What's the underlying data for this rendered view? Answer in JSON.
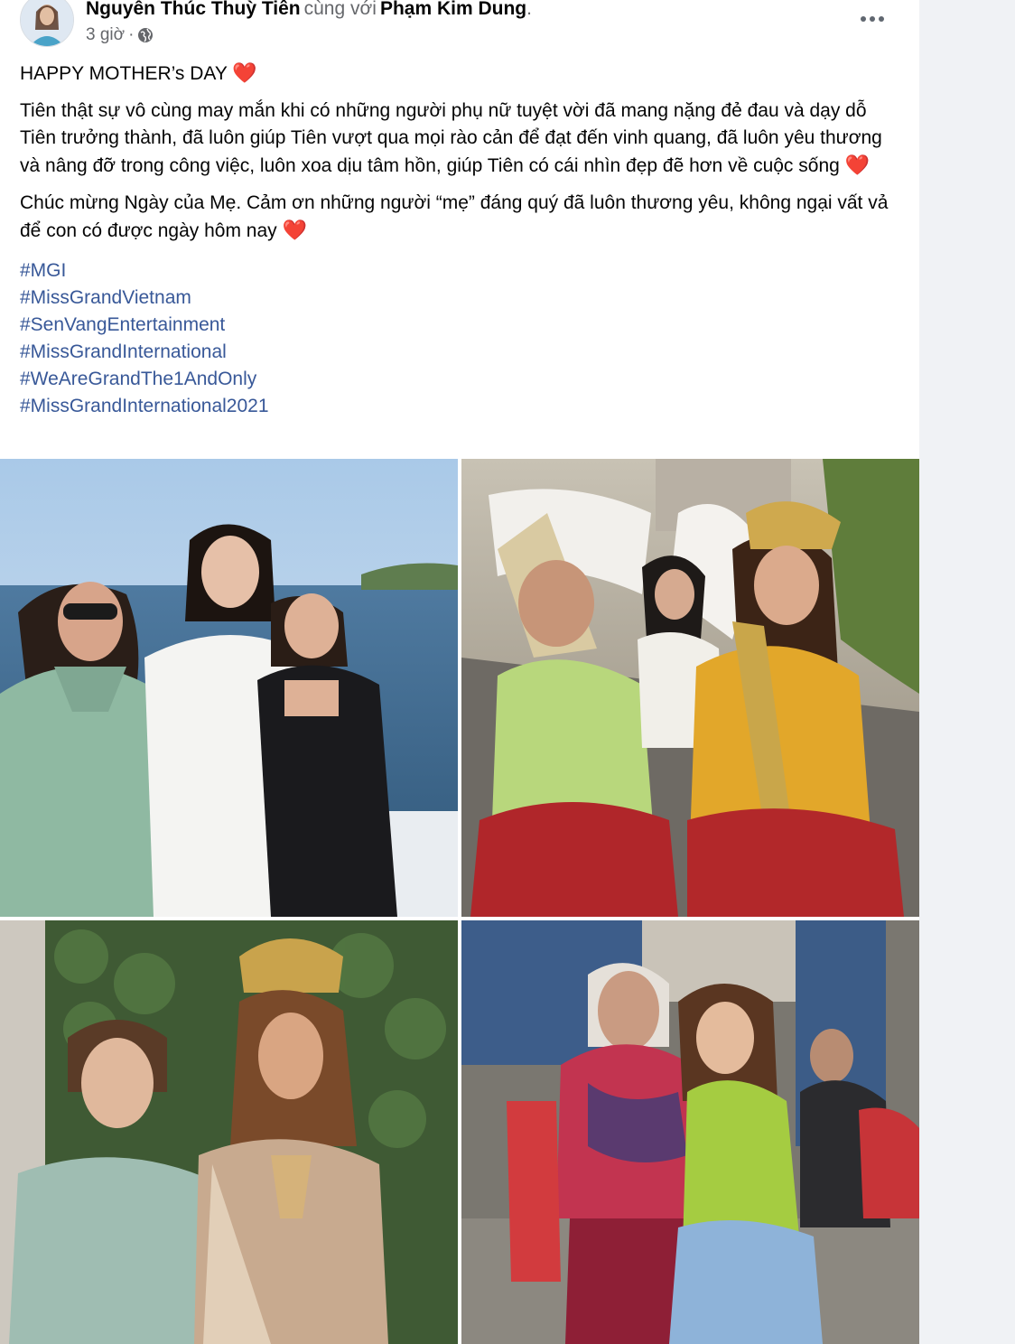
{
  "post": {
    "author": "Nguyễn Thúc Thuỳ Tiên",
    "with_text": "cùng với",
    "tagged": "Phạm Kim Dung",
    "time": "3 giờ",
    "separator": "·",
    "privacy_icon": "globe-icon",
    "more_icon": "more-options-icon",
    "paragraphs": [
      {
        "text": "HAPPY MOTHER’s DAY",
        "emoji": "❤️"
      },
      {
        "text": "Tiên thật sự vô cùng may mắn khi có những người phụ nữ tuyệt vời đã mang nặng đẻ đau và dạy dỗ Tiên trưởng thành, đã luôn giúp Tiên vượt qua mọi rào cản để đạt đến vinh quang, đã luôn yêu thương và nâng đỡ trong công việc, luôn xoa dịu tâm hồn, giúp Tiên có cái nhìn đẹp đẽ hơn về cuộc sống",
        "emoji": "❤️"
      },
      {
        "text": "Chúc mừng Ngày của Mẹ. Cảm ơn những người “mẹ” đáng quý đã luôn thương yêu, không ngại vất vả để con có được ngày hôm nay",
        "emoji": "❤️"
      }
    ],
    "hashtags": [
      "#MGI",
      "#MissGrandVietnam",
      "#SenVangEntertainment",
      "#MissGrandInternational",
      "#WeAreGrandThe1AndOnly",
      "#MissGrandInternational2021"
    ],
    "photos": [
      {
        "name": "photo-women-on-boat"
      },
      {
        "name": "photo-parade-ao-dai"
      },
      {
        "name": "photo-mother-and-crowned-daughter"
      },
      {
        "name": "photo-grandmother-and-granddaughter"
      }
    ]
  },
  "colors": {
    "text": "#050505",
    "secondary": "#65676b",
    "link": "#385898",
    "heart": "#e0245e",
    "background": "#f0f2f5"
  }
}
